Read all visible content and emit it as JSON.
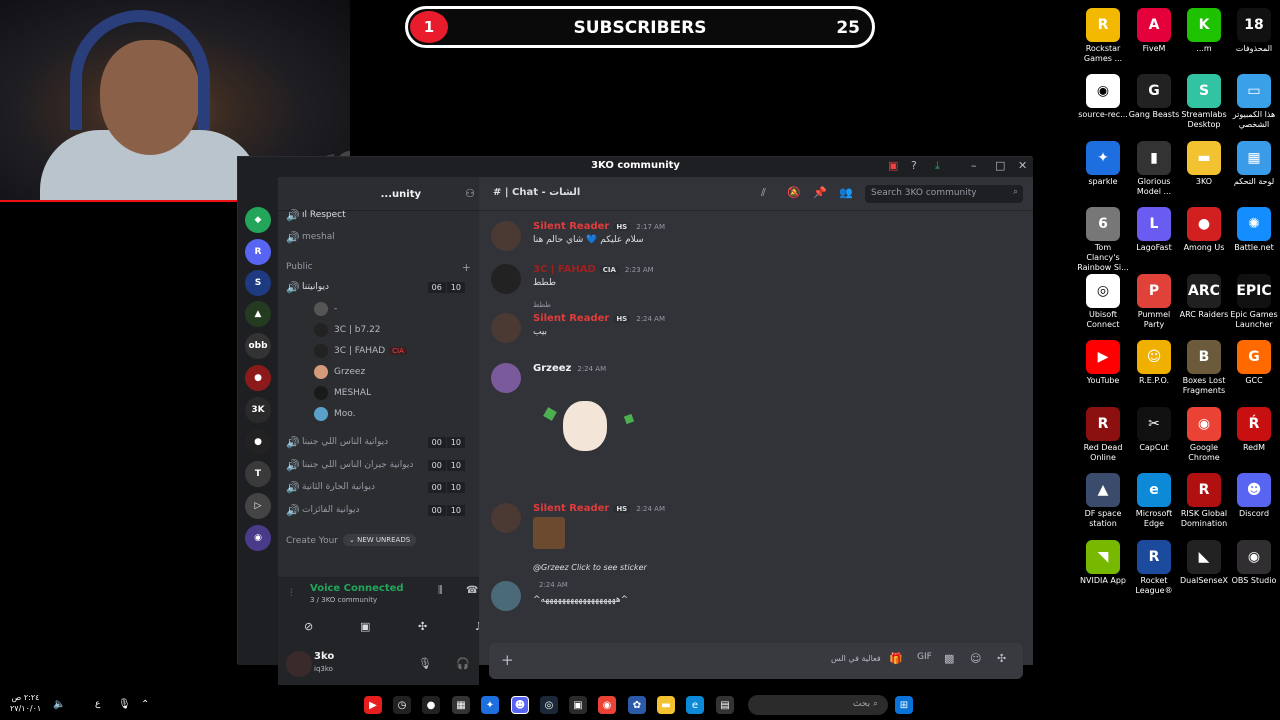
{
  "overlay": {
    "subscriber_badge": "1",
    "subscribers_label": "SUBSCRIBERS",
    "subscribers_count": "25"
  },
  "desktop_icons": [
    {
      "label": "Rockstar Games ...",
      "color": "#f3b800",
      "glyph": "R"
    },
    {
      "label": "FiveM",
      "color": "#e4003a",
      "glyph": "A"
    },
    {
      "label": "...m",
      "color": "#1ec200",
      "glyph": "K"
    },
    {
      "label": "المحذوفات",
      "color": "#111111",
      "glyph": "18"
    },
    {
      "label": "source-rec...",
      "color": "#ffffff",
      "glyph": "◉"
    },
    {
      "label": "Gang Beasts",
      "color": "#222222",
      "glyph": "G"
    },
    {
      "label": "Streamlabs Desktop",
      "color": "#31c3a2",
      "glyph": "S"
    },
    {
      "label": "هذا الكمبيوتر الشخصي",
      "color": "#3aa0e8",
      "glyph": "▭"
    },
    {
      "label": "sparkle",
      "color": "#1d6fe0",
      "glyph": "✦"
    },
    {
      "label": "Glorious Model ...",
      "color": "#333333",
      "glyph": "▮"
    },
    {
      "label": "3KO",
      "color": "#f2c230",
      "glyph": "▬"
    },
    {
      "label": "لوحة التحكم",
      "color": "#3a9be8",
      "glyph": "▦"
    },
    {
      "label": "Tom Clancy's Rainbow Si...",
      "color": "#777777",
      "glyph": "6"
    },
    {
      "label": "LagoFast",
      "color": "#6a5cf0",
      "glyph": "L"
    },
    {
      "label": "Among Us",
      "color": "#d21f1f",
      "glyph": "●"
    },
    {
      "label": "Battle.net",
      "color": "#148eff",
      "glyph": "✺"
    },
    {
      "label": "Ubisoft Connect",
      "color": "#ffffff",
      "glyph": "◎"
    },
    {
      "label": "Pummel Party",
      "color": "#e0423a",
      "glyph": "P"
    },
    {
      "label": "ARC Raiders",
      "color": "#202020",
      "glyph": "ARC"
    },
    {
      "label": "Epic Games Launcher",
      "color": "#111111",
      "glyph": "EPIC"
    },
    {
      "label": "YouTube",
      "color": "#ff0000",
      "glyph": "▶"
    },
    {
      "label": "R.E.P.O.",
      "color": "#f0b000",
      "glyph": "☺"
    },
    {
      "label": "Boxes Lost Fragments",
      "color": "#6b5a3c",
      "glyph": "B"
    },
    {
      "label": "GCC",
      "color": "#ff6a00",
      "glyph": "G"
    },
    {
      "label": "Red Dead Online",
      "color": "#8c1010",
      "glyph": "R"
    },
    {
      "label": "CapCut",
      "color": "#111111",
      "glyph": "✂"
    },
    {
      "label": "Google Chrome",
      "color": "#ea4335",
      "glyph": "◉"
    },
    {
      "label": "RedM",
      "color": "#c91010",
      "glyph": "Ŕ"
    },
    {
      "label": "DF space station",
      "color": "#3b4b6b",
      "glyph": "▲"
    },
    {
      "label": "Microsoft Edge",
      "color": "#0c8ad8",
      "glyph": "e"
    },
    {
      "label": "RISK Global Domination",
      "color": "#b01010",
      "glyph": "R"
    },
    {
      "label": "Discord",
      "color": "#5865f2",
      "glyph": "☻"
    },
    {
      "label": "NVIDIA App",
      "color": "#76b900",
      "glyph": "◥"
    },
    {
      "label": "Rocket League®",
      "color": "#1c4a9c",
      "glyph": "R"
    },
    {
      "label": "DualSenseX",
      "color": "#222222",
      "glyph": "◣"
    },
    {
      "label": "OBS Studio",
      "color": "#302e31",
      "glyph": "◉"
    }
  ],
  "discord": {
    "window_title": "3KO community",
    "server_name": "...unity",
    "channel_title": "# | Chat - الشات",
    "search_placeholder": "Search 3KO community",
    "channels_top": [
      {
        "icon": "🔊",
        "label": "ıl Respect"
      },
      {
        "icon": "🔊",
        "label": "meshal"
      }
    ],
    "public_category": "Public",
    "voice_main": {
      "label": "ديوانيتنا",
      "a": "06",
      "b": "10"
    },
    "voice_users": [
      {
        "name": "-"
      },
      {
        "name": "3C | b7.22"
      },
      {
        "name": "3C | FAHAD",
        "badge": "CIA"
      },
      {
        "name": "Grzeez"
      },
      {
        "name": "MESHAL"
      },
      {
        "name": "Moo."
      }
    ],
    "voice_rooms": [
      {
        "label": "ديوانية الناس اللي جنبنا",
        "a": "00",
        "b": "10"
      },
      {
        "label": "ديوانية جيران الناس اللي جنبنا",
        "a": "00",
        "b": "10"
      },
      {
        "label": "ديوانية الحارة الثانية",
        "a": "00",
        "b": "10"
      },
      {
        "label": "ديوانية الفائزات",
        "a": "00",
        "b": "10"
      }
    ],
    "create_label": "Create Your",
    "new_unreads": "NEW UNREADS",
    "voice_status": "Voice Connected",
    "voice_channel": "3 / 3KO community",
    "user_name": "3ko",
    "user_tag": "iq3ko",
    "messages": [
      {
        "name": "Silent Reader",
        "tag": "HS",
        "time": "2:17 AM",
        "text": "سلام عليكم 💙 شاي حالم هنا"
      },
      {
        "name": "3C | FAHAD",
        "tag": "CIA",
        "time": "2:23 AM",
        "text": "ططط"
      },
      {
        "name": "Silent Reader",
        "tag": "HS",
        "time": "2:24 AM",
        "text": "بيب",
        "reply": "ططط"
      },
      {
        "name": "Grzeez",
        "tag": "",
        "time": "2:24 AM",
        "text": ""
      },
      {
        "name": "Silent Reader",
        "tag": "HS",
        "time": "2:24 AM",
        "text": ""
      },
      {
        "name": "",
        "tag": "",
        "time": "2:24 AM",
        "text": "^ههههههههههههههههههه^",
        "reply": "@Grzeez Click to see sticker"
      }
    ],
    "input_right_text": "فعالية في الس"
  },
  "taskbar": {
    "time": "٢:٢٤ ص",
    "date": "٢٧/١٠/٠١",
    "lang": "ع",
    "search_placeholder": "بحث"
  }
}
